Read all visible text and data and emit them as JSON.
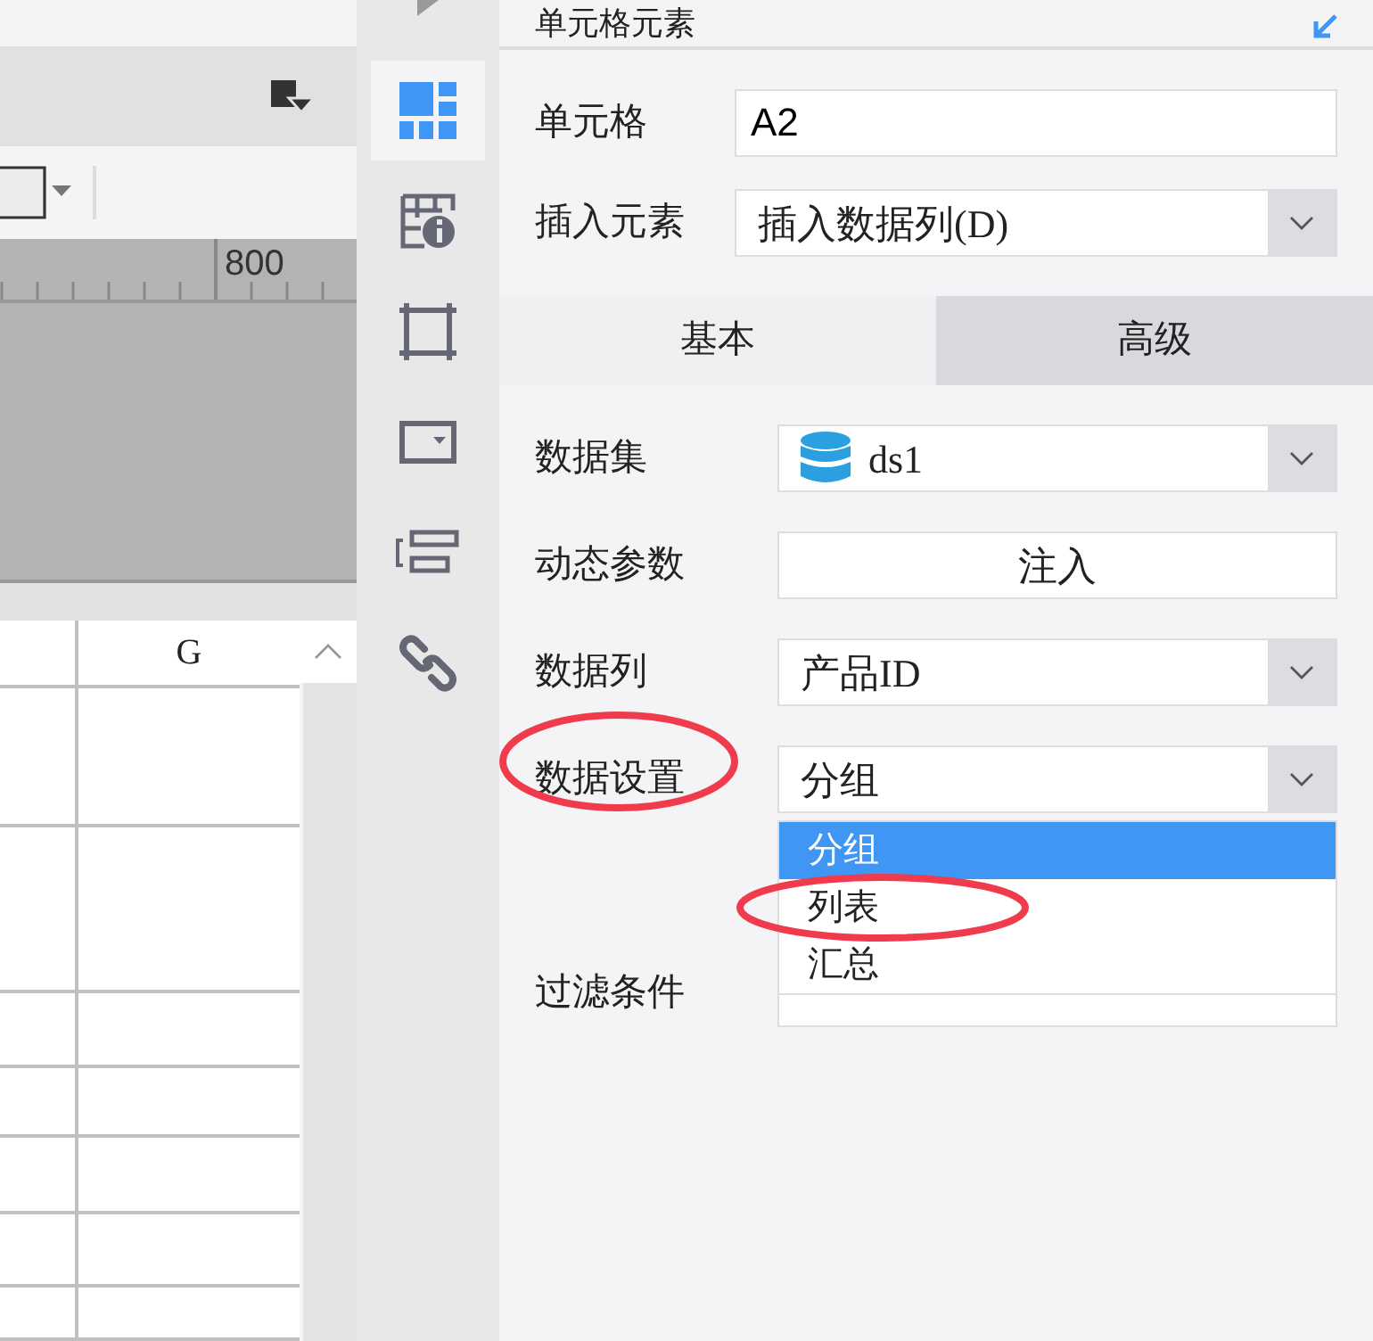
{
  "ruler": {
    "label": "800"
  },
  "sheet": {
    "column_header": "G"
  },
  "sidebar": {
    "items": [
      {
        "kind": "cell",
        "selected": true
      },
      {
        "kind": "table-info",
        "selected": false
      },
      {
        "kind": "frame",
        "selected": false
      },
      {
        "kind": "dropdown",
        "selected": false
      },
      {
        "kind": "form",
        "selected": false
      },
      {
        "kind": "link",
        "selected": false
      }
    ]
  },
  "panel": {
    "title": "单元格元素",
    "cell": {
      "label": "单元格",
      "value": "A2"
    },
    "insert": {
      "label": "插入元素",
      "value": "插入数据列(D)"
    },
    "tabs": [
      {
        "label": "基本",
        "selected": true
      },
      {
        "label": "高级",
        "selected": false
      }
    ],
    "fields": [
      {
        "kind": "dataset",
        "label": "数据集",
        "value": "ds1"
      },
      {
        "kind": "button",
        "label": "动态参数",
        "value": "注入"
      },
      {
        "kind": "select",
        "label": "数据列",
        "value": "产品ID"
      },
      {
        "kind": "select",
        "label": "数据设置",
        "value": "分组",
        "circled": true,
        "expanded": true,
        "options": [
          {
            "label": "分组",
            "selected": true,
            "circled": false
          },
          {
            "label": "列表",
            "selected": false,
            "circled": true
          },
          {
            "label": "汇总",
            "selected": false,
            "circled": false
          }
        ]
      },
      {
        "kind": "button",
        "label": "过滤条件"
      }
    ]
  }
}
